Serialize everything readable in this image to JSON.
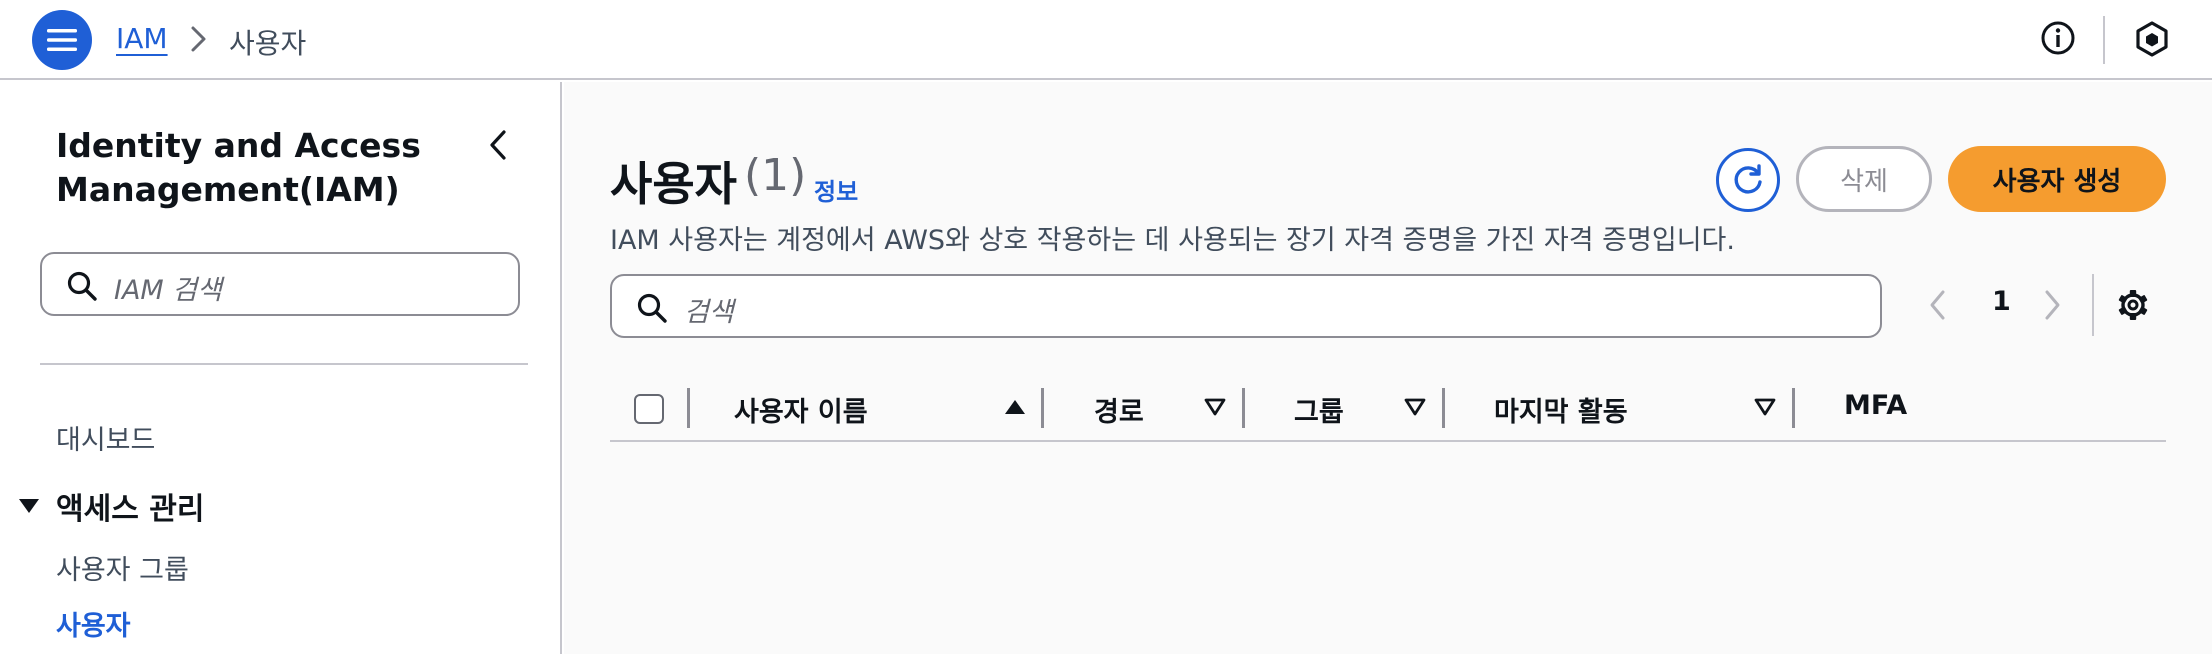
{
  "topbar": {
    "breadcrumb_root": "IAM",
    "breadcrumb_current": "사용자"
  },
  "sidebar": {
    "title": "Identity and Access Management(IAM)",
    "search_placeholder": "IAM 검색",
    "items": {
      "dashboard": "대시보드",
      "access_group": "액세스 관리",
      "user_groups": "사용자 그룹",
      "users": "사용자"
    }
  },
  "main": {
    "title": "사용자",
    "count": "(1)",
    "info_link": "정보",
    "description": "IAM 사용자는 계정에서 AWS와 상호 작용하는 데 사용되는 장기 자격 증명을 가진 자격 증명입니다.",
    "delete_label": "삭제",
    "create_label": "사용자 생성",
    "search_placeholder": "검색",
    "pagination": {
      "current_page": "1"
    },
    "table": {
      "columns": [
        "사용자 이름",
        "경로",
        "그룹",
        "마지막 활동",
        "MFA"
      ]
    }
  },
  "colors": {
    "accent": "#1f5fd6",
    "primary_button": "#f59c2f",
    "border": "#c6c6cd"
  }
}
